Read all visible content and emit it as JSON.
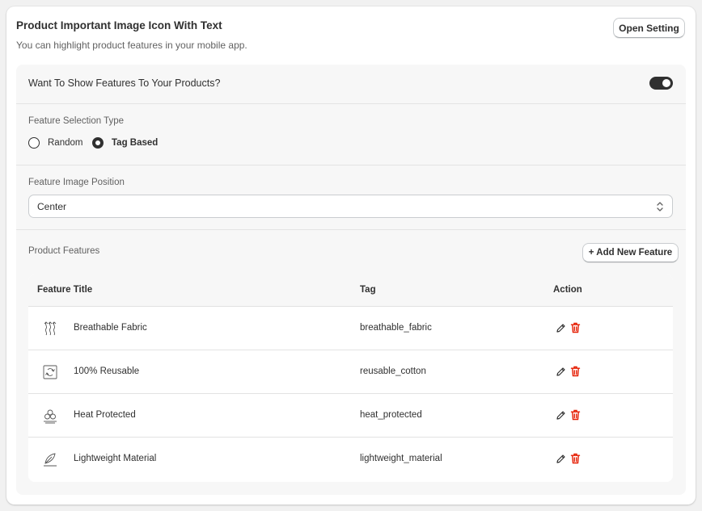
{
  "header": {
    "title": "Product Important Image Icon With Text",
    "subtitle": "You can highlight product features in your mobile app.",
    "open_setting_label": "Open Setting"
  },
  "show_features": {
    "label": "Want To Show Features To Your Products?",
    "enabled": true
  },
  "selection_type": {
    "label": "Feature Selection Type",
    "options": [
      {
        "label": "Random",
        "selected": false
      },
      {
        "label": "Tag Based",
        "selected": true
      }
    ]
  },
  "image_position": {
    "label": "Feature Image Position",
    "value": "Center"
  },
  "features": {
    "label": "Product Features",
    "add_label": "+ Add New Feature",
    "columns": [
      "Feature Title",
      "Tag",
      "Action"
    ],
    "rows": [
      {
        "icon": "breathable-fabric-icon",
        "title": "Breathable Fabric",
        "tag": "breathable_fabric"
      },
      {
        "icon": "reusable-icon",
        "title": "100% Reusable",
        "tag": "reusable_cotton"
      },
      {
        "icon": "heat-protected-icon",
        "title": "Heat Protected",
        "tag": "heat_protected"
      },
      {
        "icon": "lightweight-feather-icon",
        "title": "Lightweight Material",
        "tag": "lightweight_material"
      }
    ]
  },
  "colors": {
    "delete": "#e51c00",
    "toggle_on": "#303030"
  }
}
